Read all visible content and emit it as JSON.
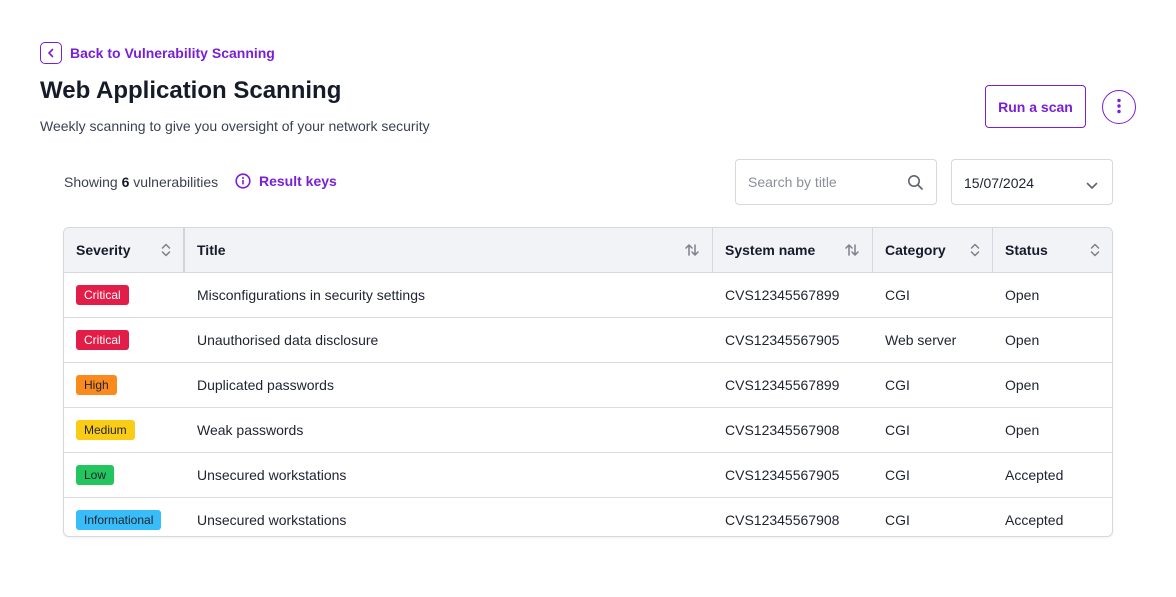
{
  "back_link": {
    "label": "Back to Vulnerability Scanning"
  },
  "header": {
    "title": "Web Application Scanning",
    "subtitle": "Weekly scanning to give you oversight of your network security",
    "run_scan_label": "Run a scan"
  },
  "toolbar": {
    "showing_prefix": "Showing",
    "count": "6",
    "showing_suffix": "vulnerabilities",
    "result_keys_label": "Result keys",
    "search_placeholder": "Search by title",
    "date_value": "15/07/2024"
  },
  "table": {
    "columns": [
      "Severity",
      "Title",
      "System name",
      "Category",
      "Status"
    ],
    "rows": [
      {
        "severity": "Critical",
        "title": "Misconfigurations in security settings",
        "system": "CVS12345567899",
        "category": "CGI",
        "status": "Open"
      },
      {
        "severity": "Critical",
        "title": "Unauthorised data disclosure",
        "system": "CVS12345567905",
        "category": "Web server",
        "status": "Open"
      },
      {
        "severity": "High",
        "title": "Duplicated passwords",
        "system": "CVS12345567899",
        "category": "CGI",
        "status": "Open"
      },
      {
        "severity": "Medium",
        "title": "Weak passwords",
        "system": "CVS12345567908",
        "category": "CGI",
        "status": "Open"
      },
      {
        "severity": "Low",
        "title": "Unsecured workstations",
        "system": "CVS12345567905",
        "category": "CGI",
        "status": "Accepted"
      },
      {
        "severity": "Informational",
        "title": "Unsecured workstations",
        "system": "CVS12345567908",
        "category": "CGI",
        "status": "Accepted"
      }
    ]
  },
  "colors": {
    "accent": "#7a1ed8",
    "critical": "#e11d48",
    "high": "#fb8a1e",
    "medium": "#facc15",
    "low": "#22c55e",
    "informational": "#38bdf8"
  },
  "icons": {
    "back": "chevron-left-icon",
    "more": "more-vertical-icon",
    "info": "info-icon",
    "search": "search-icon",
    "date": "chevron-down-icon",
    "sort": "sort-icon"
  }
}
